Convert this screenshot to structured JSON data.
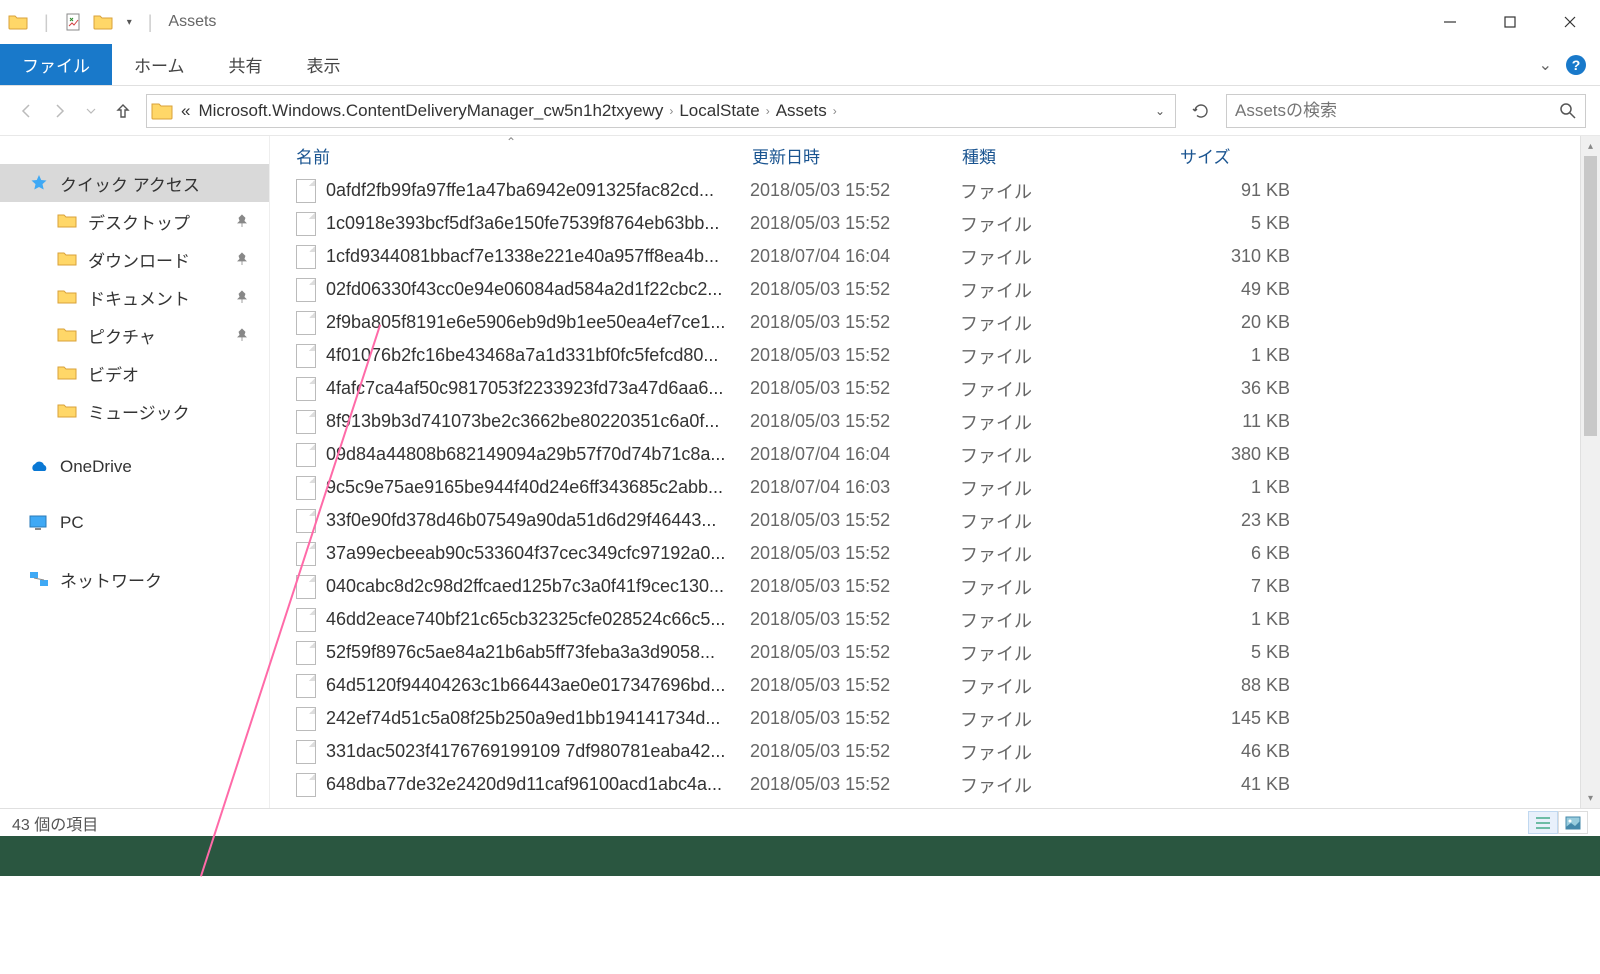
{
  "titlebar": {
    "title": "Assets"
  },
  "ribbon": {
    "file": "ファイル",
    "home": "ホーム",
    "share": "共有",
    "view": "表示"
  },
  "breadcrumbs": {
    "prefix": "«",
    "items": [
      "Microsoft.Windows.ContentDeliveryManager_cw5n1h2txyewy",
      "LocalState",
      "Assets"
    ]
  },
  "search": {
    "placeholder": "Assetsの検索"
  },
  "sidebar": {
    "quick_access": "クイック アクセス",
    "items": [
      {
        "label": "デスクトップ",
        "pinned": true
      },
      {
        "label": "ダウンロード",
        "pinned": true
      },
      {
        "label": "ドキュメント",
        "pinned": true
      },
      {
        "label": "ピクチャ",
        "pinned": true
      },
      {
        "label": "ビデオ",
        "pinned": false
      },
      {
        "label": "ミュージック",
        "pinned": false
      }
    ],
    "onedrive": "OneDrive",
    "pc": "PC",
    "network": "ネットワーク"
  },
  "columns": {
    "name": "名前",
    "date": "更新日時",
    "type": "種類",
    "size": "サイズ"
  },
  "files": [
    {
      "name": "0afdf2fb99fa97ffe1a47ba6942e091325fac82cd...",
      "date": "2018/05/03 15:52",
      "type": "ファイル",
      "size": "91 KB"
    },
    {
      "name": "1c0918e393bcf5df3a6e150fe7539f8764eb63bb...",
      "date": "2018/05/03 15:52",
      "type": "ファイル",
      "size": "5 KB"
    },
    {
      "name": "1cfd9344081bbacf7e1338e221e40a957ff8ea4b...",
      "date": "2018/07/04 16:04",
      "type": "ファイル",
      "size": "310 KB"
    },
    {
      "name": "02fd06330f43cc0e94e06084ad584a2d1f22cbc2...",
      "date": "2018/05/03 15:52",
      "type": "ファイル",
      "size": "49 KB"
    },
    {
      "name": "2f9ba805f8191e6e5906eb9d9b1ee50ea4ef7ce1...",
      "date": "2018/05/03 15:52",
      "type": "ファイル",
      "size": "20 KB"
    },
    {
      "name": "4f01076b2fc16be43468a7a1d331bf0fc5fefcd80...",
      "date": "2018/05/03 15:52",
      "type": "ファイル",
      "size": "1 KB"
    },
    {
      "name": "4fafc7ca4af50c9817053f2233923fd73a47d6aa6...",
      "date": "2018/05/03 15:52",
      "type": "ファイル",
      "size": "36 KB"
    },
    {
      "name": "8f913b9b3d741073be2c3662be80220351c6a0f...",
      "date": "2018/05/03 15:52",
      "type": "ファイル",
      "size": "11 KB"
    },
    {
      "name": "09d84a44808b682149094a29b57f70d74b71c8a...",
      "date": "2018/07/04 16:04",
      "type": "ファイル",
      "size": "380 KB"
    },
    {
      "name": "9c5c9e75ae9165be944f40d24e6ff343685c2abb...",
      "date": "2018/07/04 16:03",
      "type": "ファイル",
      "size": "1 KB"
    },
    {
      "name": "33f0e90fd378d46b07549a90da51d6d29f46443...",
      "date": "2018/05/03 15:52",
      "type": "ファイル",
      "size": "23 KB"
    },
    {
      "name": "37a99ecbeeab90c533604f37cec349cfc97192a0...",
      "date": "2018/05/03 15:52",
      "type": "ファイル",
      "size": "6 KB"
    },
    {
      "name": "040cabc8d2c98d2ffcaed125b7c3a0f41f9cec130...",
      "date": "2018/05/03 15:52",
      "type": "ファイル",
      "size": "7 KB"
    },
    {
      "name": "46dd2eace740bf21c65cb32325cfe028524c66c5...",
      "date": "2018/05/03 15:52",
      "type": "ファイル",
      "size": "1 KB"
    },
    {
      "name": "52f59f8976c5ae84a21b6ab5ff73feba3a3d9058...",
      "date": "2018/05/03 15:52",
      "type": "ファイル",
      "size": "5 KB"
    },
    {
      "name": "64d5120f94404263c1b66443ae0e017347696bd...",
      "date": "2018/05/03 15:52",
      "type": "ファイル",
      "size": "88 KB"
    },
    {
      "name": "242ef74d51c5a08f25b250a9ed1bb194141734d...",
      "date": "2018/05/03 15:52",
      "type": "ファイル",
      "size": "145 KB"
    },
    {
      "name": "331dac5023f4176769199109 7df980781eaba42...",
      "date": "2018/05/03 15:52",
      "type": "ファイル",
      "size": "46 KB"
    },
    {
      "name": "648dba77de32e2420d9d11caf96100acd1abc4a...",
      "date": "2018/05/03 15:52",
      "type": "ファイル",
      "size": "41 KB"
    }
  ],
  "status": {
    "text": "43 個の項目"
  }
}
